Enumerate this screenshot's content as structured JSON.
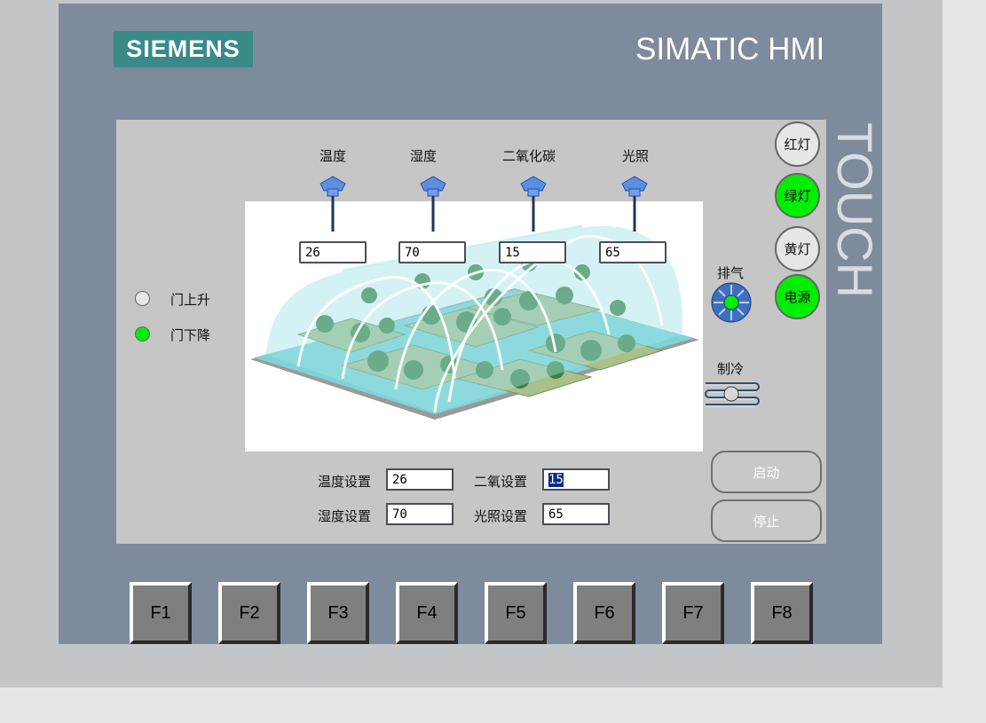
{
  "brand": {
    "logo": "SIEMENS",
    "model": "SIMATIC HMI",
    "touch": "TOUCH"
  },
  "sensors": [
    {
      "label": "温度",
      "value": "26"
    },
    {
      "label": "湿度",
      "value": "70"
    },
    {
      "label": "二氧化碳",
      "value": "15"
    },
    {
      "label": "光照",
      "value": "65"
    }
  ],
  "door": {
    "up_label": "门上升",
    "down_label": "门下降",
    "up_state": "off",
    "down_state": "on"
  },
  "lights": {
    "red": "红灯",
    "green": "绿灯",
    "yellow": "黄灯",
    "power": "电源"
  },
  "devices": {
    "exhaust": "排气",
    "cooling": "制冷"
  },
  "settings": {
    "temp_label": "温度设置",
    "temp_value": "26",
    "humidity_label": "湿度设置",
    "humidity_value": "70",
    "co2_label": "二氧设置",
    "co2_value": "15",
    "light_label": "光照设置",
    "light_value": "65"
  },
  "buttons": {
    "start": "启动",
    "stop": "停止"
  },
  "fkeys": [
    "F1",
    "F2",
    "F3",
    "F4",
    "F5",
    "F6",
    "F7",
    "F8"
  ],
  "colors": {
    "on": "#00ee00",
    "off": "#e6e6e6",
    "bezel": "#7d8b9d",
    "logo": "#3a8a8a"
  }
}
